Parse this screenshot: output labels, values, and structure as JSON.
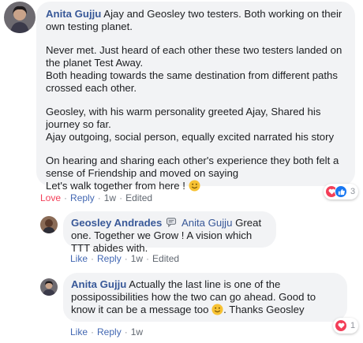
{
  "comment": {
    "author": "Anita Gujju",
    "intro": "Ajay and Geosley two testers. Both working on their own testing planet.",
    "para2_line1": "Never met. Just heard of each other these two testers landed on the planet Test Away.",
    "para2_line2": "Both heading towards the same destination from different paths crossed each other.",
    "para3_line1": "Geosley, with his warm personality greeted Ajay, Shared his journey so far.",
    "para3_line2": "Ajay outgoing, social person, equally excited narrated his story",
    "para4_line1": "On hearing and sharing each other's experience they both felt a sense of Friendship and moved on saying",
    "para4_line2": "Let's walk together from here !",
    "actions": {
      "love": "Love",
      "reply": "Reply",
      "time": "1w",
      "edited": "Edited"
    },
    "reaction_count": "3"
  },
  "reply1": {
    "author": "Geosley Andrades",
    "mention": "Anita Gujju",
    "text": "Great one. Together we Grow ! A vision which TTT abides with.",
    "actions": {
      "like": "Like",
      "reply": "Reply",
      "time": "1w",
      "edited": "Edited"
    }
  },
  "reply2": {
    "author": "Anita Gujju",
    "text_line": "Actually the last line is one of the possipossibilities how the two can go ahead. Good to know it can be a message too",
    "text_end": ". Thanks Geosley",
    "actions": {
      "like": "Like",
      "reply": "Reply",
      "time": "1w"
    },
    "reaction_count": "1"
  },
  "colors": {
    "link": "#385898",
    "action": "#4267b2",
    "love": "#f33e58",
    "like": "#1877f2",
    "bubble": "#f2f3f5"
  }
}
